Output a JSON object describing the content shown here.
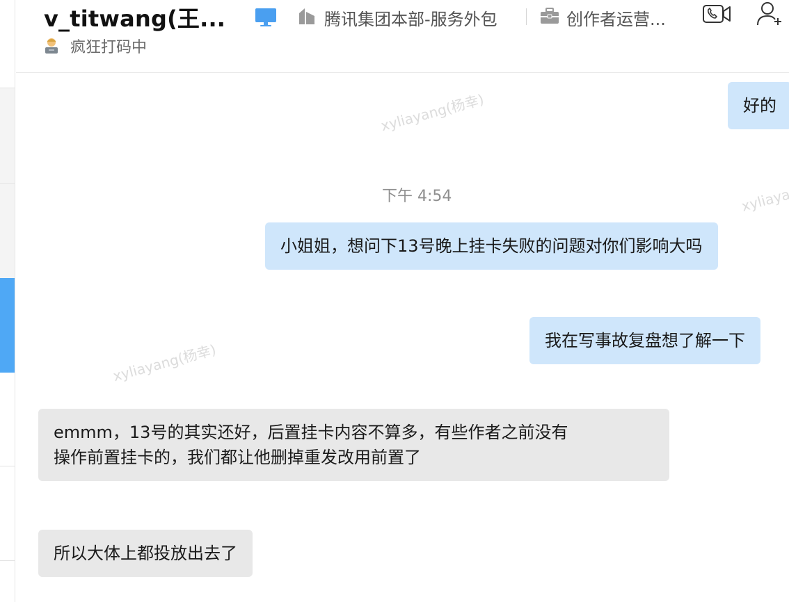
{
  "header": {
    "contact_name": "v_titwang(王...",
    "status_text": "疯狂打码中",
    "org_label": "腾讯集团本部-服务外包",
    "dept_label": "创作者运营..."
  },
  "watermarks": [
    "xyliayang(杨幸)",
    "xyliayang(杨幸)",
    "xyliaya"
  ],
  "messages": [
    {
      "sender": "me",
      "text": "好的"
    },
    {
      "type": "timestamp",
      "text": "下午 4:54"
    },
    {
      "sender": "me",
      "text": "小姐姐，想问下13号晚上挂卡失败的问题对你们影响大吗"
    },
    {
      "sender": "me",
      "text": "我在写事故复盘想了解一下"
    },
    {
      "sender": "them",
      "lines": [
        "emmm，13号的其实还好，后置挂卡内容不算多，有些作者之前没有",
        "操作前置挂卡的，我们都让他删掉重发改用前置了"
      ]
    },
    {
      "sender": "them",
      "text": "所以大体上都投放出去了"
    }
  ],
  "colors": {
    "my_bubble": "#cfe6fb",
    "their_bubble": "#e8e8e8",
    "selected_rail": "#4fa8f5",
    "desktop_icon": "#4a9ff0"
  },
  "icons": [
    "person-emoji-icon",
    "desktop-icon",
    "building-icon",
    "briefcase-icon",
    "video-call-icon",
    "add-person-icon"
  ]
}
